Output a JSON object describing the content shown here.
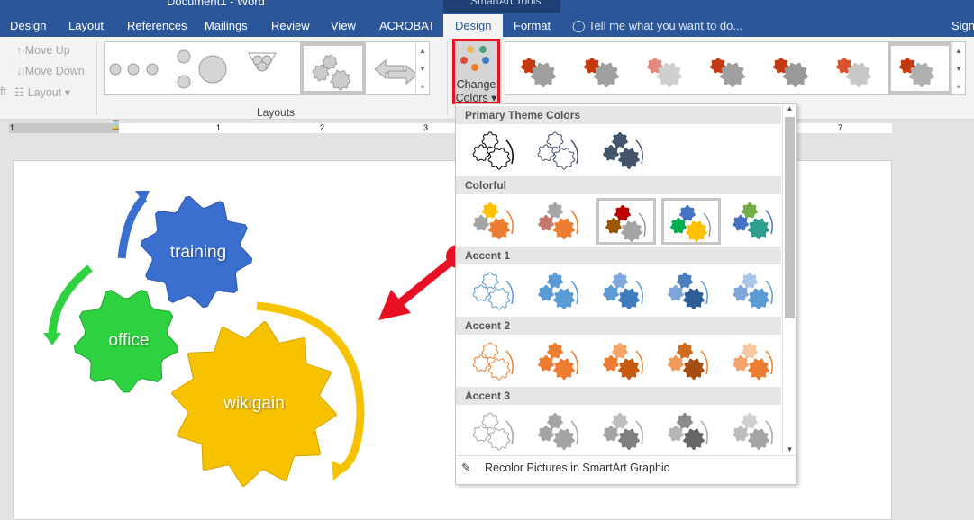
{
  "window": {
    "title": "Document1 - Word",
    "context_label": "SmartArt Tools"
  },
  "tabs": [
    {
      "label": "Design"
    },
    {
      "label": "Layout"
    },
    {
      "label": "References"
    },
    {
      "label": "Mailings"
    },
    {
      "label": "Review"
    },
    {
      "label": "View"
    },
    {
      "label": "ACROBAT"
    }
  ],
  "context_tabs": [
    {
      "label": "Design",
      "active": true
    },
    {
      "label": "Format"
    }
  ],
  "tell_me": "Tell me what you want to do...",
  "sign_in": "Sign",
  "ribbon": {
    "move_up": "Move Up",
    "move_down": "Move Down",
    "layout": "Layout",
    "left_fragment": "ft",
    "layouts_group": "Layouts",
    "change_colors": [
      "Change",
      "Colors"
    ]
  },
  "ruler": {
    "labels": [
      "1",
      "1",
      "2",
      "3",
      "7"
    ]
  },
  "dropdown": {
    "sections": [
      {
        "title": "Primary Theme Colors",
        "thumbs": [
          [
            "#fff",
            "#fff",
            "#fff",
            "#000"
          ],
          [
            "#fff",
            "#fff",
            "#fff",
            "#44546a"
          ],
          [
            "#44546a",
            "#44546a",
            "#44546a",
            "#44546a"
          ]
        ]
      },
      {
        "title": "Colorful",
        "thumbs": [
          [
            "#ffc000",
            "#a5a5a5",
            "#ed7d31",
            "#ed7d31"
          ],
          [
            "#a5a5a5",
            "#c4796a",
            "#ed7d31",
            "#ed7d31"
          ],
          [
            "#c00000",
            "#9c5700",
            "#a5a5a5",
            "#999"
          ],
          [
            "#4472c4",
            "#00b050",
            "#ffc000",
            "#999"
          ],
          [
            "#70ad47",
            "#4472c4",
            "#2f9e8f",
            "#4472c4"
          ]
        ],
        "selected": [
          2,
          3
        ]
      },
      {
        "title": "Accent 1",
        "thumbs": [
          [
            "#fff",
            "#fff",
            "#fff",
            "#5b9bd5"
          ],
          [
            "#5b9bd5",
            "#5b9bd5",
            "#5b9bd5",
            "#5b9bd5"
          ],
          [
            "#7fa9dc",
            "#5b9bd5",
            "#3f7cc0",
            "#5b9bd5"
          ],
          [
            "#4a7fc0",
            "#7ea6d8",
            "#2e5d94",
            "#5b9bd5"
          ],
          [
            "#a9c6ea",
            "#7ea6d8",
            "#5b9bd5",
            "#5b9bd5"
          ]
        ]
      },
      {
        "title": "Accent 2",
        "thumbs": [
          [
            "#fff",
            "#fff",
            "#fff",
            "#ed7d31"
          ],
          [
            "#ed7d31",
            "#ed7d31",
            "#ed7d31",
            "#ed7d31"
          ],
          [
            "#f4a46b",
            "#ed7d31",
            "#c55a11",
            "#ed7d31"
          ],
          [
            "#d06a1e",
            "#f09a5c",
            "#a54e14",
            "#ed7d31"
          ],
          [
            "#f8c6a0",
            "#f4a46b",
            "#ed7d31",
            "#ed7d31"
          ]
        ]
      },
      {
        "title": "Accent 3",
        "thumbs": [
          [
            "#fff",
            "#fff",
            "#fff",
            "#a5a5a5"
          ],
          [
            "#a5a5a5",
            "#a5a5a5",
            "#a5a5a5",
            "#a5a5a5"
          ],
          [
            "#bdbdbd",
            "#a5a5a5",
            "#7f7f7f",
            "#a5a5a5"
          ],
          [
            "#8c8c8c",
            "#b5b5b5",
            "#666",
            "#a5a5a5"
          ],
          [
            "#d0d0d0",
            "#bdbdbd",
            "#a5a5a5",
            "#a5a5a5"
          ]
        ]
      }
    ],
    "recolor": "Recolor Pictures in SmartArt Graphic"
  },
  "diagram": {
    "nodes": [
      {
        "label": "training",
        "color": "#3a6fd0"
      },
      {
        "label": "office",
        "color": "#2ed13f"
      },
      {
        "label": "wikigain",
        "color": "#f7c300"
      }
    ],
    "annotation_arrow_color": "#e81123"
  }
}
